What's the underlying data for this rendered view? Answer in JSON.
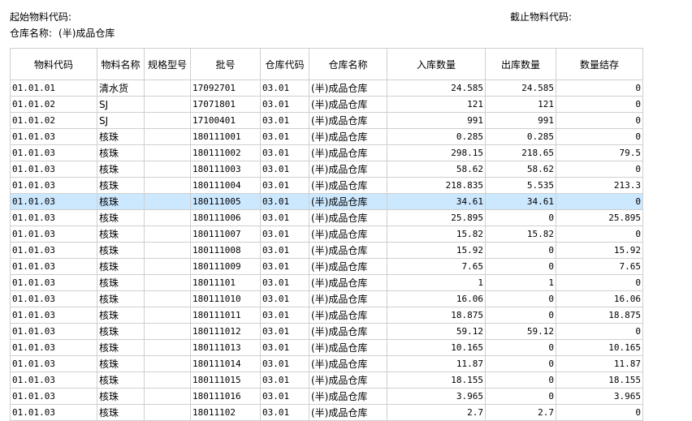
{
  "header": {
    "start_code_label": "起始物料代码:",
    "end_code_label": "截止物料代码:",
    "warehouse_label": "仓库名称:",
    "warehouse_value": "(半)成品仓库"
  },
  "table": {
    "columns": [
      "物料代码",
      "物料名称",
      "规格型号",
      "批号",
      "仓库代码",
      "仓库名称",
      "入库数量",
      "出库数量",
      "数量结存"
    ],
    "selected_row": 7,
    "rows": [
      [
        "01.01.01",
        "清水货",
        "",
        "17092701",
        "03.01",
        "(半)成品仓库",
        "24.585",
        "24.585",
        "0"
      ],
      [
        "01.01.02",
        "SJ",
        "",
        "17071801",
        "03.01",
        "(半)成品仓库",
        "121",
        "121",
        "0"
      ],
      [
        "01.01.02",
        "SJ",
        "",
        "17100401",
        "03.01",
        "(半)成品仓库",
        "991",
        "991",
        "0"
      ],
      [
        "01.01.03",
        "核珠",
        "",
        "180111001",
        "03.01",
        "(半)成品仓库",
        "0.285",
        "0.285",
        "0"
      ],
      [
        "01.01.03",
        "核珠",
        "",
        "180111002",
        "03.01",
        "(半)成品仓库",
        "298.15",
        "218.65",
        "79.5"
      ],
      [
        "01.01.03",
        "核珠",
        "",
        "180111003",
        "03.01",
        "(半)成品仓库",
        "58.62",
        "58.62",
        "0"
      ],
      [
        "01.01.03",
        "核珠",
        "",
        "180111004",
        "03.01",
        "(半)成品仓库",
        "218.835",
        "5.535",
        "213.3"
      ],
      [
        "01.01.03",
        "核珠",
        "",
        "180111005",
        "03.01",
        "(半)成品仓库",
        "34.61",
        "34.61",
        "0"
      ],
      [
        "01.01.03",
        "核珠",
        "",
        "180111006",
        "03.01",
        "(半)成品仓库",
        "25.895",
        "0",
        "25.895"
      ],
      [
        "01.01.03",
        "核珠",
        "",
        "180111007",
        "03.01",
        "(半)成品仓库",
        "15.82",
        "15.82",
        "0"
      ],
      [
        "01.01.03",
        "核珠",
        "",
        "180111008",
        "03.01",
        "(半)成品仓库",
        "15.92",
        "0",
        "15.92"
      ],
      [
        "01.01.03",
        "核珠",
        "",
        "180111009",
        "03.01",
        "(半)成品仓库",
        "7.65",
        "0",
        "7.65"
      ],
      [
        "01.01.03",
        "核珠",
        "",
        "18011101",
        "03.01",
        "(半)成品仓库",
        "1",
        "1",
        "0"
      ],
      [
        "01.01.03",
        "核珠",
        "",
        "180111010",
        "03.01",
        "(半)成品仓库",
        "16.06",
        "0",
        "16.06"
      ],
      [
        "01.01.03",
        "核珠",
        "",
        "180111011",
        "03.01",
        "(半)成品仓库",
        "18.875",
        "0",
        "18.875"
      ],
      [
        "01.01.03",
        "核珠",
        "",
        "180111012",
        "03.01",
        "(半)成品仓库",
        "59.12",
        "59.12",
        "0"
      ],
      [
        "01.01.03",
        "核珠",
        "",
        "180111013",
        "03.01",
        "(半)成品仓库",
        "10.165",
        "0",
        "10.165"
      ],
      [
        "01.01.03",
        "核珠",
        "",
        "180111014",
        "03.01",
        "(半)成品仓库",
        "11.87",
        "0",
        "11.87"
      ],
      [
        "01.01.03",
        "核珠",
        "",
        "180111015",
        "03.01",
        "(半)成品仓库",
        "18.155",
        "0",
        "18.155"
      ],
      [
        "01.01.03",
        "核珠",
        "",
        "180111016",
        "03.01",
        "(半)成品仓库",
        "3.965",
        "0",
        "3.965"
      ],
      [
        "01.01.03",
        "核珠",
        "",
        "18011102",
        "03.01",
        "(半)成品仓库",
        "2.7",
        "2.7",
        "0"
      ]
    ]
  },
  "colors": {
    "selected_row_bg": "#cce8ff",
    "grid_line": "#cfcfcf"
  }
}
